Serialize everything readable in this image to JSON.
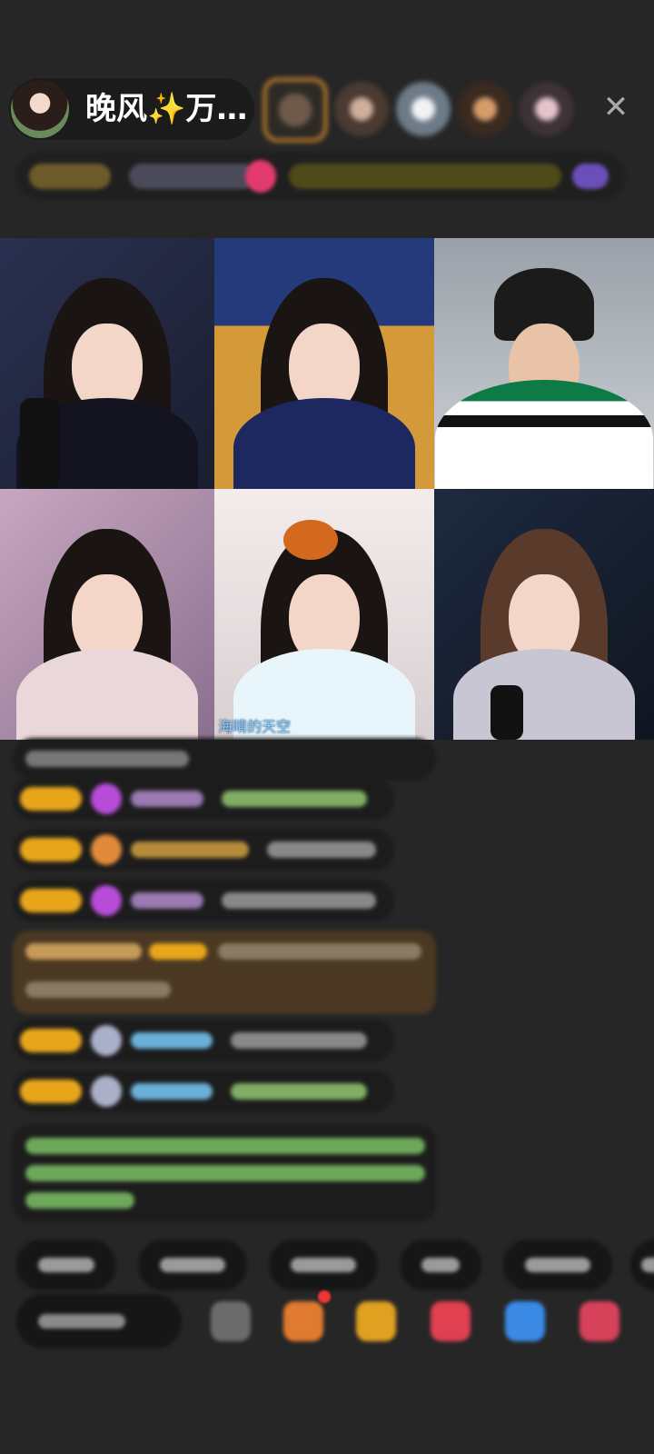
{
  "host": {
    "name": "晚风✨万…"
  },
  "header": {
    "close_icon": "close-icon"
  },
  "grid": {
    "tile_5_caption": "海晴的天空"
  },
  "colors": {
    "background": "#262626",
    "badge": "#e9a61b",
    "chat_green": "#8ad46c",
    "chat_blue": "#6ab0d8"
  }
}
